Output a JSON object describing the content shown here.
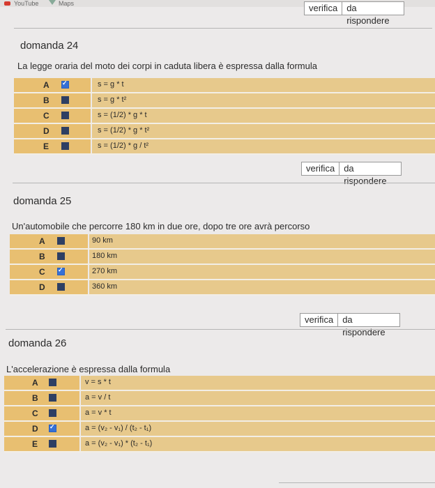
{
  "browser": {
    "tab1": "YouTube",
    "tab2": "Maps"
  },
  "verify_label": "verifica",
  "status_label": "da rispondere",
  "questions": [
    {
      "title": "domanda 24",
      "text": "La legge oraria del moto dei corpi in caduta libera è espressa dalla formula",
      "options": [
        {
          "letter": "A",
          "checked": true,
          "text": "s = g * t"
        },
        {
          "letter": "B",
          "checked": false,
          "text": "s = g * t²"
        },
        {
          "letter": "C",
          "checked": false,
          "text": "s = (1/2) * g * t"
        },
        {
          "letter": "D",
          "checked": false,
          "text": "s = (1/2) * g * t²"
        },
        {
          "letter": "E",
          "checked": false,
          "text": "s = (1/2) * g / t²"
        }
      ]
    },
    {
      "title": "domanda 25",
      "text": "Un'automobile che percorre 180 km in due ore, dopo tre ore avrà percorso",
      "options": [
        {
          "letter": "A",
          "checked": false,
          "text": "90 km"
        },
        {
          "letter": "B",
          "checked": false,
          "text": "180 km"
        },
        {
          "letter": "C",
          "checked": true,
          "text": "270 km"
        },
        {
          "letter": "D",
          "checked": false,
          "text": "360 km"
        }
      ]
    },
    {
      "title": "domanda 26",
      "text": "L'accelerazione è espressa dalla formula",
      "options": [
        {
          "letter": "A",
          "checked": false,
          "text": "v = s * t"
        },
        {
          "letter": "B",
          "checked": false,
          "text": "a = v / t"
        },
        {
          "letter": "C",
          "checked": false,
          "text": "a = v * t"
        },
        {
          "letter": "D",
          "checked": true,
          "text": "a = (v₂ - v₁) / (t₂ - t₁)"
        },
        {
          "letter": "E",
          "checked": false,
          "text": "a = (v₂ - v₁) * (t₂ - t₁)"
        }
      ]
    }
  ]
}
